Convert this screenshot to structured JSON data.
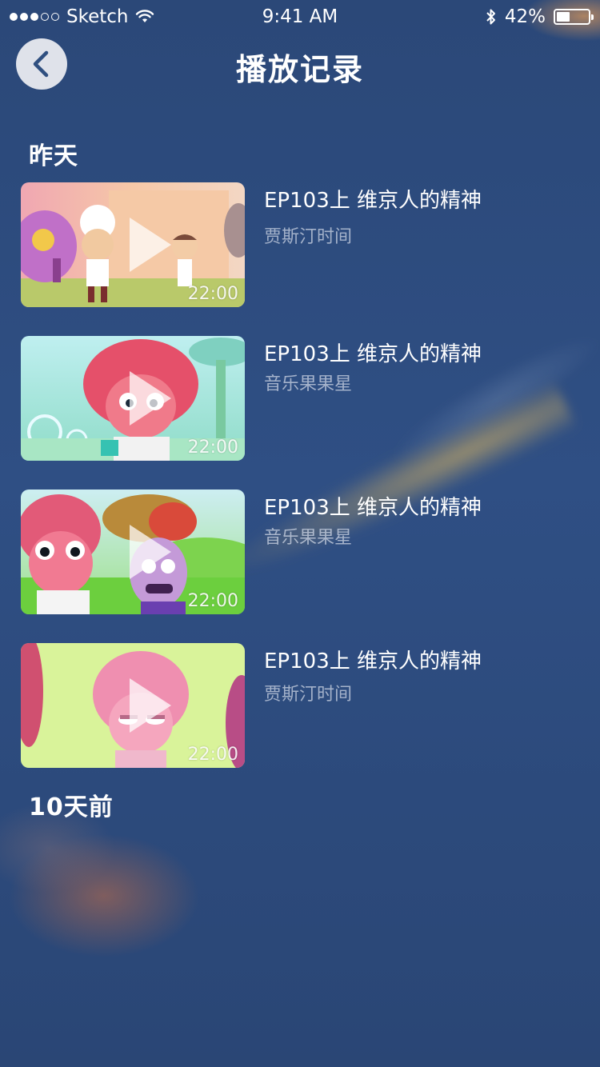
{
  "status_bar": {
    "carrier": "Sketch",
    "time": "9:41 AM",
    "battery_text": "42%",
    "battery_level": 0.42,
    "signal_dots_filled": 3,
    "signal_dots_total": 5
  },
  "header": {
    "title": "播放记录",
    "back_icon": "chevron-left-icon"
  },
  "sections": [
    {
      "title": "昨天",
      "items": [
        {
          "title": "EP103上 维京人的精神",
          "subtitle": "贾斯汀时间",
          "duration": "22:00"
        },
        {
          "title": "EP103上 维京人的精神",
          "subtitle": "音乐果果星",
          "duration": "22:00"
        },
        {
          "title": "EP103上 维京人的精神",
          "subtitle": "音乐果果星",
          "duration": "22:00"
        },
        {
          "title": "EP103上 维京人的精神",
          "subtitle": "贾斯汀时间",
          "duration": "22:00"
        }
      ]
    },
    {
      "title": "10天前",
      "items": []
    }
  ],
  "colors": {
    "background": "#2c4a7c",
    "text": "#ffffff",
    "subtitle": "#d2dae8",
    "back_button": "#dfe2ea"
  }
}
